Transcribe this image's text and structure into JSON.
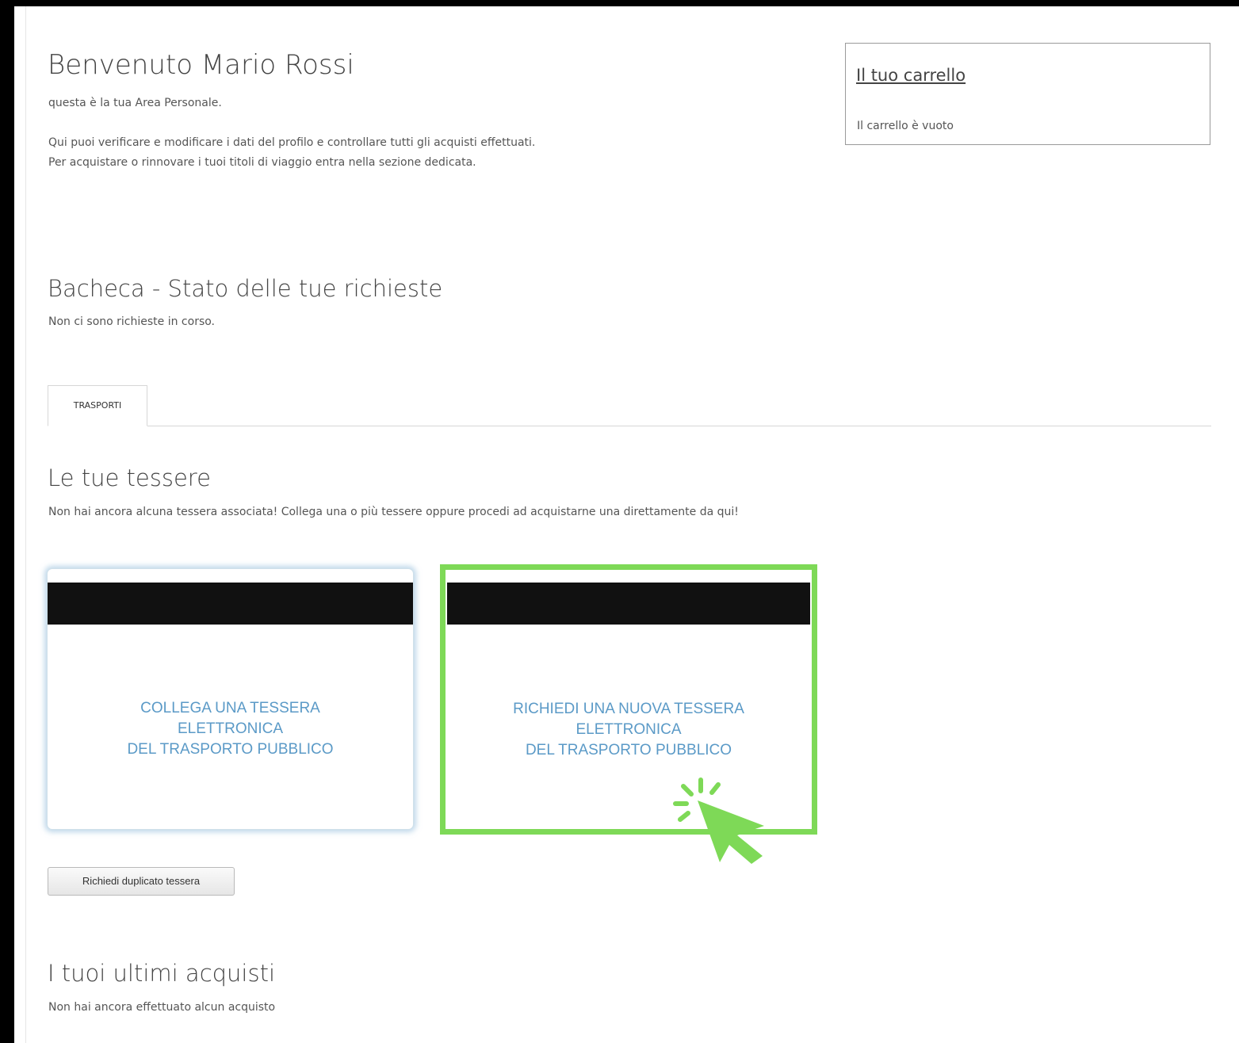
{
  "welcome": {
    "title": "Benvenuto Mario Rossi",
    "subtitle": "questa è la tua Area Personale.",
    "line1": "Qui puoi verificare e modificare i dati del profilo e controllare tutti gli acquisti effettuati.",
    "line2": "Per acquistare o rinnovare i tuoi titoli di viaggio entra nella sezione dedicata."
  },
  "cart": {
    "title": "Il tuo carrello",
    "status": "Il carrello è vuoto"
  },
  "bacheca": {
    "title": "Bacheca - Stato delle tue richieste",
    "status": "Non ci sono richieste in corso."
  },
  "tabs": [
    {
      "label": "TRASPORTI",
      "active": true
    }
  ],
  "tessere": {
    "title": "Le tue tessere",
    "description": "Non hai ancora alcuna tessera associata! Collega una o più tessere oppure procedi ad acquistarne una direttamente da qui!",
    "cards": [
      {
        "label": "COLLEGA UNA TESSERA\nELETTRONICA\nDEL TRASPORTO PUBBLICO"
      },
      {
        "label": "RICHIEDI UNA NUOVA TESSERA\nELETTRONICA\nDEL TRASPORTO PUBBLICO",
        "highlighted": true
      }
    ],
    "duplicate_button": "Richiedi duplicato tessera"
  },
  "acquisti": {
    "title": "I tuoi ultimi acquisti",
    "status": "Non hai ancora effettuato alcun acquisto"
  },
  "colors": {
    "highlight": "#7ed957",
    "card_text": "#5b9ac7"
  },
  "icons": {
    "pointer": "click-pointer-icon"
  }
}
